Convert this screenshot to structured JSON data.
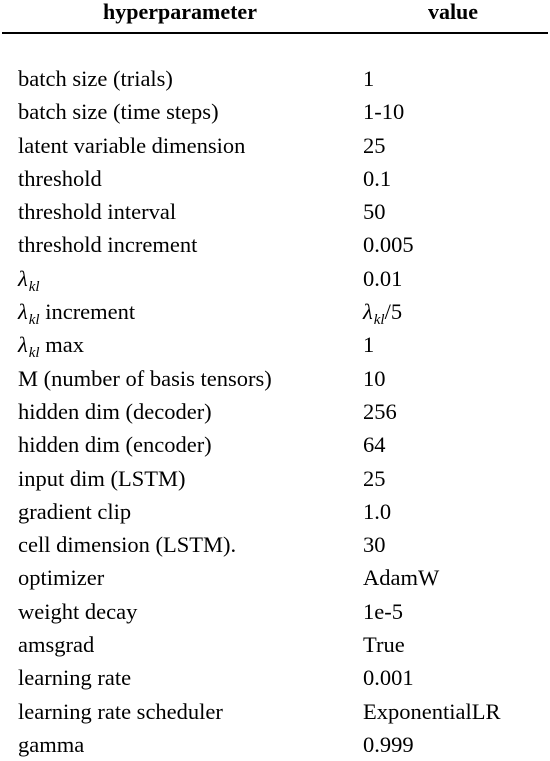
{
  "table": {
    "headers": {
      "name": "hyperparameter",
      "value": "value"
    },
    "rows": [
      {
        "name": "batch size (trials)",
        "value": "1"
      },
      {
        "name": "batch size (time steps)",
        "value": "1-10"
      },
      {
        "name": "latent variable dimension",
        "value": "25"
      },
      {
        "name": "threshold",
        "value": "0.1"
      },
      {
        "name": "threshold interval",
        "value": "50"
      },
      {
        "name": "threshold increment",
        "value": "0.005"
      },
      {
        "name_symbol": "λ",
        "name_sub": "kl",
        "name_suffix": "",
        "value": "0.01"
      },
      {
        "name_symbol": "λ",
        "name_sub": "kl",
        "name_suffix": " increment",
        "value_symbol": "λ",
        "value_sub": "kl",
        "value_suffix": "/5"
      },
      {
        "name_symbol": "λ",
        "name_sub": "kl",
        "name_suffix": " max",
        "value": "1"
      },
      {
        "name": "M (number of basis tensors)",
        "value": "10"
      },
      {
        "name": "hidden dim (decoder)",
        "value": "256"
      },
      {
        "name": "hidden dim (encoder)",
        "value": "64"
      },
      {
        "name": "input dim (LSTM)",
        "value": "25"
      },
      {
        "name": "gradient clip",
        "value": "1.0"
      },
      {
        "name": "cell dimension (LSTM).",
        "value": "30"
      },
      {
        "name": "optimizer",
        "value": "AdamW"
      },
      {
        "name": "weight decay",
        "value": "1e-5"
      },
      {
        "name": "amsgrad",
        "value": "True"
      },
      {
        "name": "learning rate",
        "value": "0.001"
      },
      {
        "name": "learning rate scheduler",
        "value": "ExponentialLR"
      },
      {
        "name": "gamma",
        "value": "0.999"
      }
    ]
  }
}
